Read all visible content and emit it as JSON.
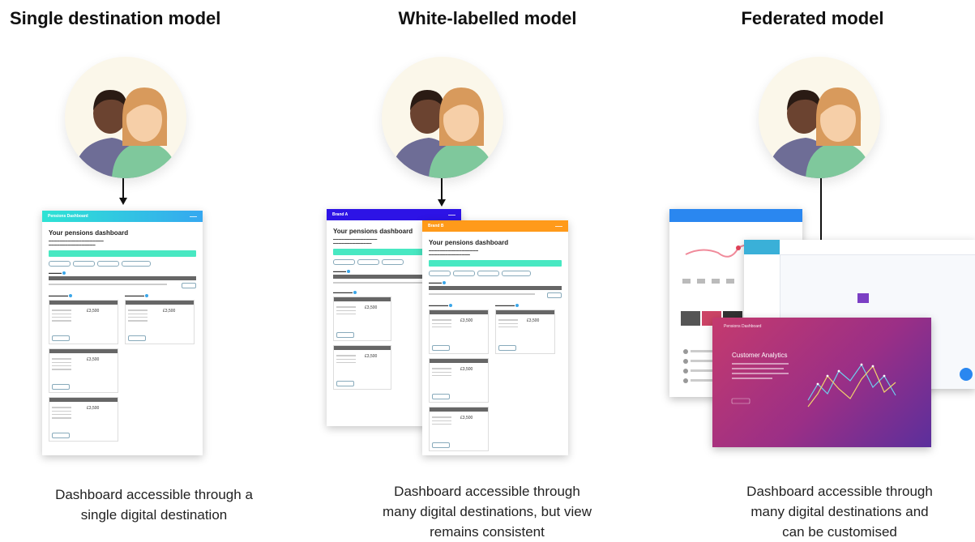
{
  "columns": [
    {
      "title": "Single destination model",
      "caption": [
        "Dashboard accessible through a",
        "single digital destination"
      ]
    },
    {
      "title": "White-labelled model",
      "caption": [
        "Dashboard accessible through",
        "many digital destinations, but view",
        "remains consistent"
      ]
    },
    {
      "title": "Federated model",
      "caption": [
        "Dashboard accessible through",
        "many digital destinations and",
        "can be customised"
      ]
    }
  ],
  "single_dashboard": {
    "header": "Pensions Dashboard",
    "title": "Your pensions dashboard",
    "amount": "£3,500",
    "header_color": "#2ee3d4"
  },
  "white_dashboard_a": {
    "header": "Brand A",
    "title": "Your pensions dashboard",
    "amount": "£3,500",
    "header_color": "#2d13e6"
  },
  "white_dashboard_b": {
    "header": "Brand B",
    "title": "Your pensions dashboard",
    "amount": "£3,500",
    "header_color": "#ff9a1a"
  },
  "federated": {
    "main_title": "Pensions Dashboard",
    "chart_title": "Customer Analytics"
  },
  "colors": {
    "skin_light": "#f6cfa8",
    "skin_dark": "#6b4330",
    "hair_light": "#d89a5c",
    "hair_dark": "#2a1b14",
    "shirt_green": "#7fc89c",
    "shirt_purple": "#6e6d96",
    "circle_bg": "#fbf7ea"
  },
  "icons": [
    "people-icon"
  ]
}
